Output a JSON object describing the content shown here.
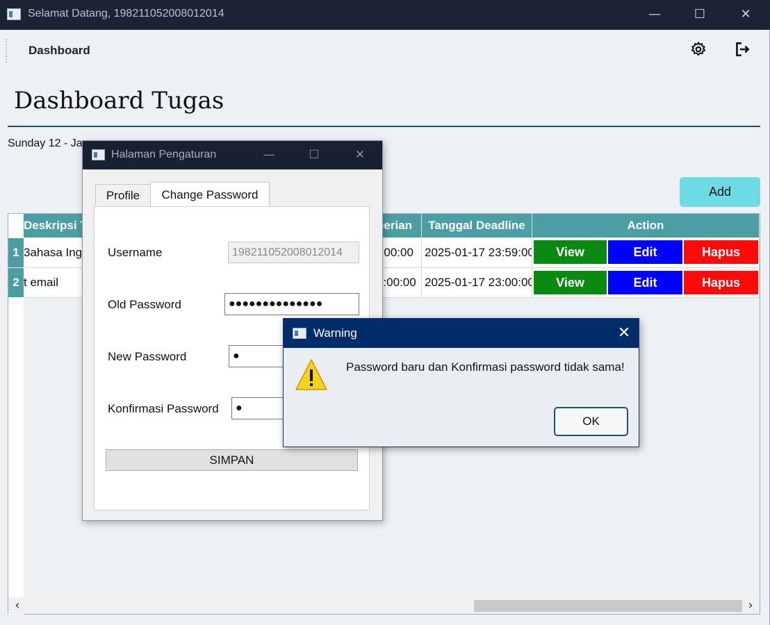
{
  "window": {
    "title": "Selamat Datang, 198211052008012014",
    "minimize": "—",
    "maximize": "☐",
    "close": "✕"
  },
  "nav": {
    "title": "Dashboard",
    "settings_icon": "gear-icon",
    "logout_icon": "logout-icon"
  },
  "page": {
    "title": "Dashboard Tugas",
    "date": "Sunday 12 - Ja",
    "add_label": "Add"
  },
  "table": {
    "headers": [
      "Deskripsi T",
      "berian",
      "Tanggal Deadline",
      "Action"
    ],
    "rows": [
      {
        "num": "1",
        "desc": "3ahasa Ingg",
        "given": "):00:00",
        "deadline": "2025-01-17 23:59:00",
        "view": "View",
        "edit": "Edit",
        "hapus": "Hapus"
      },
      {
        "num": "2",
        "desc": "t email",
        "given": "3:00:00",
        "deadline": "2025-01-17 23:00:00",
        "view": "View",
        "edit": "Edit",
        "hapus": "Hapus"
      }
    ],
    "colors": {
      "header": "#4b9ea3",
      "view": "#0b8a12",
      "edit": "#0000ff",
      "hapus": "#ff0a0a"
    }
  },
  "settings_dialog": {
    "title": "Halaman Pengaturan",
    "tabs": [
      "Profile",
      "Change Password"
    ],
    "active_tab": "Change Password",
    "fields": {
      "username_label": "Username",
      "username_value": "198211052008012014",
      "old_password_label": "Old Password",
      "old_password_value": "●●●●●●●●●●●●●●",
      "new_password_label": "New Password",
      "new_password_value": "●",
      "confirm_password_label": "Konfirmasi Password",
      "confirm_password_value": "●"
    },
    "save_label": "SIMPAN"
  },
  "warning_dialog": {
    "title": "Warning",
    "close": "✕",
    "message": "Password baru dan Konfirmasi password tidak sama!",
    "ok_label": "OK",
    "icon": "warning-icon"
  }
}
